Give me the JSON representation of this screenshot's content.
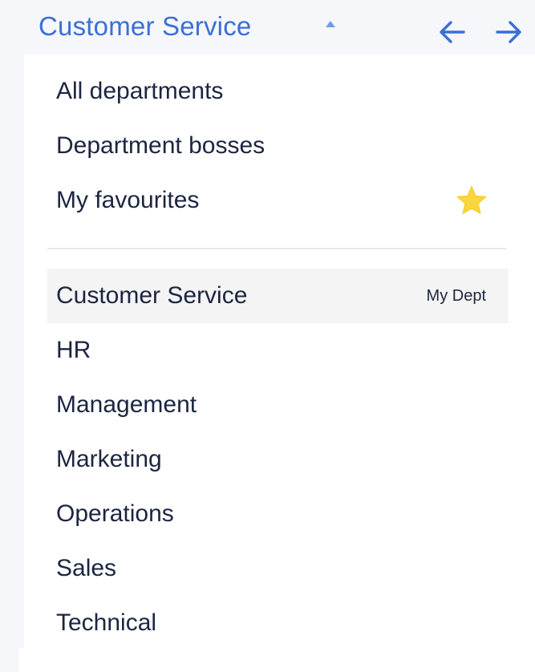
{
  "header": {
    "current_department": "Customer Service",
    "caret_icon": "caret-up-icon",
    "prev_icon": "arrow-left-icon",
    "next_icon": "arrow-right-icon",
    "accent_color": "#3b6fd6"
  },
  "filters": [
    {
      "label": "All departments"
    },
    {
      "label": "Department bosses"
    },
    {
      "label": "My favourites",
      "icon": "star-icon",
      "icon_color": "#f8d63c"
    }
  ],
  "departments": [
    {
      "label": "Customer Service",
      "badge": "My Dept",
      "selected": true
    },
    {
      "label": "HR"
    },
    {
      "label": "Management"
    },
    {
      "label": "Marketing"
    },
    {
      "label": "Operations"
    },
    {
      "label": "Sales"
    },
    {
      "label": "Technical"
    }
  ]
}
